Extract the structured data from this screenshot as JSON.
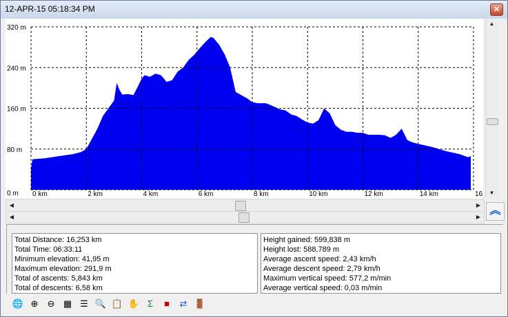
{
  "window": {
    "title": "12-APR-15 05:18:34 PM",
    "close_label": "✕"
  },
  "chart_data": {
    "type": "area",
    "xlabel": "",
    "ylabel": "",
    "xlim": [
      0,
      16
    ],
    "ylim": [
      0,
      320
    ],
    "x_ticks": [
      "0 km",
      "2 km",
      "4 km",
      "6 km",
      "8 km",
      "10 km",
      "12 km",
      "14 km",
      "16"
    ],
    "y_ticks": [
      "0 m",
      "80 m",
      "160 m",
      "240 m",
      "320 m"
    ],
    "grid": true,
    "color": "#0000f0",
    "x": [
      0,
      0.05,
      0.5,
      1,
      1.5,
      1.8,
      2,
      2.2,
      2.4,
      2.6,
      2.8,
      3.0,
      3.1,
      3.2,
      3.3,
      3.5,
      3.7,
      3.8,
      4.0,
      4.1,
      4.3,
      4.5,
      4.7,
      4.9,
      5.1,
      5.3,
      5.5,
      5.7,
      5.9,
      6.1,
      6.3,
      6.5,
      6.6,
      6.8,
      7.0,
      7.2,
      7.4,
      7.6,
      7.8,
      8.0,
      8.2,
      8.5,
      8.8,
      9.0,
      9.2,
      9.4,
      9.6,
      9.8,
      10.0,
      10.2,
      10.4,
      10.6,
      10.8,
      11.0,
      11.2,
      11.4,
      11.6,
      11.8,
      12.0,
      12.2,
      12.4,
      12.6,
      12.8,
      13.0,
      13.2,
      13.4,
      13.6,
      13.7,
      13.8,
      14.0,
      14.5,
      15,
      15.5,
      15.8,
      15.9
    ],
    "values": [
      42,
      60,
      62,
      66,
      70,
      74,
      80,
      100,
      120,
      145,
      160,
      175,
      210,
      196,
      187,
      188,
      186,
      196,
      218,
      225,
      222,
      228,
      225,
      212,
      215,
      232,
      240,
      255,
      265,
      278,
      290,
      300,
      298,
      285,
      266,
      240,
      192,
      186,
      180,
      172,
      170,
      170,
      163,
      158,
      156,
      148,
      145,
      138,
      132,
      130,
      137,
      160,
      150,
      127,
      118,
      114,
      114,
      112,
      112,
      108,
      108,
      108,
      107,
      102,
      108,
      120,
      98,
      95,
      93,
      90,
      84,
      76,
      70,
      64,
      66
    ],
    "gridline_values": {
      "x": [
        0,
        2,
        4,
        6,
        8,
        10,
        12,
        14,
        16
      ],
      "y": [
        0,
        80,
        160,
        240,
        320
      ]
    }
  },
  "stats_left": [
    "Total Distance: 16,253 km",
    "Total Time: 06:33:11",
    "Minimum elevation: 41,95 m",
    "Maximum elevation: 291,9 m",
    "Total of ascents: 5,843 km",
    "Total of descents: 6,58 km"
  ],
  "stats_right": [
    "Height gained: 599,838 m",
    "Height lost: 588,789 m",
    "Average ascent speed: 2,43 km/h",
    "Average descent speed: 2,79 km/h",
    "Maximum vertical speed: 577,2 m/min",
    "Average vertical speed: 0,03 m/min"
  ],
  "toolbar": {
    "icons": [
      {
        "name": "map-globe-icon",
        "glyph": "🌐"
      },
      {
        "name": "zoom-in-icon",
        "glyph": "⊕"
      },
      {
        "name": "zoom-out-icon",
        "glyph": "⊖"
      },
      {
        "name": "grid-icon",
        "glyph": "▦"
      },
      {
        "name": "list-options-icon",
        "glyph": "☰"
      },
      {
        "name": "search-icon",
        "glyph": "🔍"
      },
      {
        "name": "clipboard-icon",
        "glyph": "📋"
      },
      {
        "name": "hand-tool-icon",
        "glyph": "✋"
      },
      {
        "name": "sigma-icon",
        "glyph": "Σ"
      },
      {
        "name": "red-book-icon",
        "glyph": "■"
      },
      {
        "name": "swap-arrows-icon",
        "glyph": "⇄"
      },
      {
        "name": "exit-door-icon",
        "glyph": "🚪"
      }
    ]
  },
  "expand_icon": "︽"
}
